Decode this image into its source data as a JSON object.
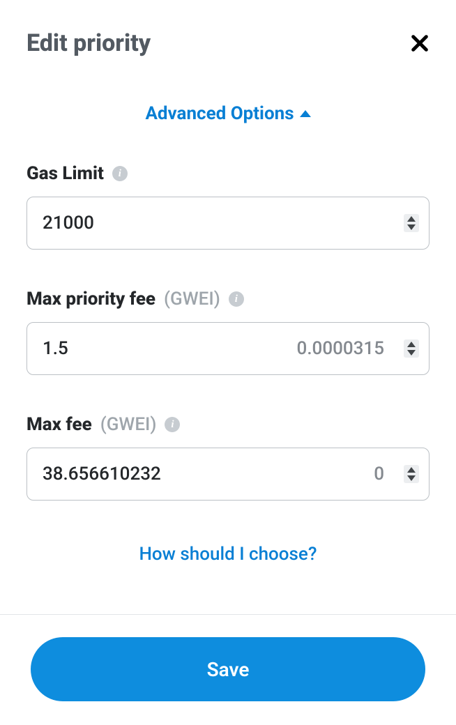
{
  "header": {
    "title": "Edit priority"
  },
  "advanced": {
    "label": "Advanced Options"
  },
  "fields": {
    "gasLimit": {
      "label": "Gas Limit",
      "value": "21000"
    },
    "maxPriorityFee": {
      "label": "Max priority fee",
      "unit": "(GWEI)",
      "value": "1.5",
      "converted": "0.0000315"
    },
    "maxFee": {
      "label": "Max fee",
      "unit": "(GWEI)",
      "value": "38.656610232",
      "converted": "0"
    }
  },
  "helpLink": "How should I choose?",
  "saveLabel": "Save"
}
